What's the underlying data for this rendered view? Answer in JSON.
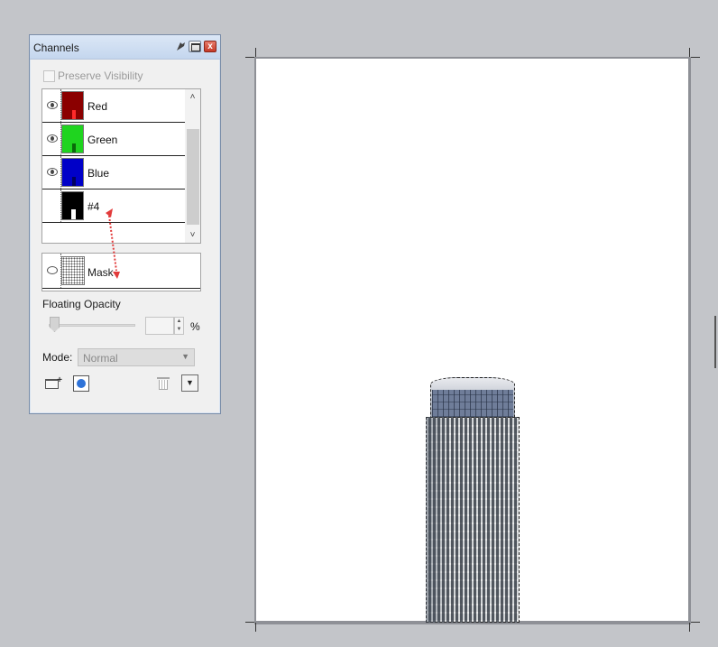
{
  "palette": {
    "title": "Channels",
    "preserve_visibility_label": "Preserve Visibility",
    "preserve_visibility_checked": false,
    "channels": [
      {
        "label": "Red",
        "visible": true,
        "thumb_color": "#8b0000",
        "thumb_mark": "#ff2a2a"
      },
      {
        "label": "Green",
        "visible": true,
        "thumb_color": "#1fd41f",
        "thumb_mark": "#0a6a0a"
      },
      {
        "label": "Blue",
        "visible": true,
        "thumb_color": "#0000c8",
        "thumb_mark": "#000060"
      },
      {
        "label": "#4",
        "visible": false,
        "thumb_color": "#000000",
        "thumb_mark": "#ffffff"
      }
    ],
    "mask": {
      "label": "Mask",
      "visible": true
    },
    "floating_opacity_label": "Floating Opacity",
    "floating_opacity_value": "",
    "percent_label": "%",
    "mode_label": "Mode:",
    "mode_value": "Normal",
    "close_glyph": "x"
  },
  "icons": {
    "pin": "pin-icon",
    "eye": "eye-icon",
    "new_folder": "new-folder-icon",
    "load_selection": "load-selection-icon",
    "trash": "trash-icon",
    "menu": "menu-arrow-icon"
  },
  "colors": {
    "drag_arrow": "#e23b3b",
    "title_bar": "#c4d6ee",
    "workspace": "#c3c5c9"
  }
}
